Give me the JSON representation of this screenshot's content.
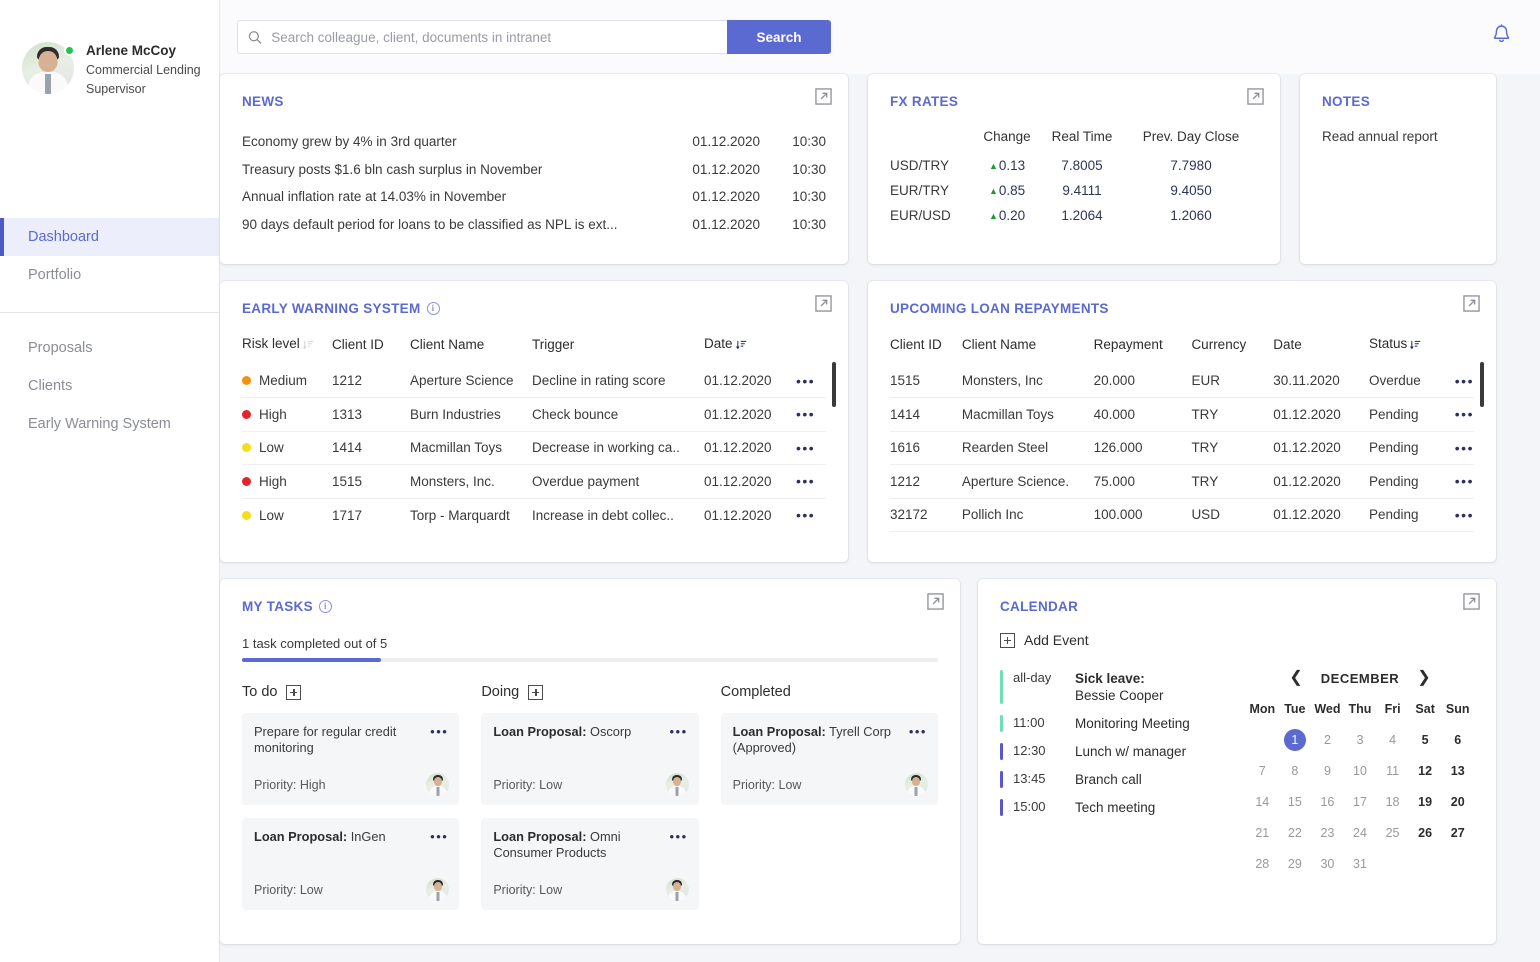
{
  "sidebar": {
    "profile": {
      "name": "Arlene McCoy",
      "role_line1": "Commercial Lending",
      "role_line2": "Supervisor"
    },
    "items": [
      {
        "label": "Dashboard",
        "active": true
      },
      {
        "label": "Portfolio",
        "active": false
      },
      {
        "label": "Proposals",
        "active": false
      },
      {
        "label": "Clients",
        "active": false
      },
      {
        "label": "Early Warning System",
        "active": false
      }
    ]
  },
  "topbar": {
    "search_placeholder": "Search colleague, client, documents in intranet",
    "search_value": "",
    "search_button": "Search",
    "bell_icon": "bell-icon"
  },
  "news": {
    "title": "NEWS",
    "rows": [
      {
        "title": "Economy grew by 4% in 3rd quarter",
        "date": "01.12.2020",
        "time": "10:30"
      },
      {
        "title": "Treasury posts $1.6 bln cash surplus in November",
        "date": "01.12.2020",
        "time": "10:30"
      },
      {
        "title": "Annual inflation rate at 14.03% in November",
        "date": "01.12.2020",
        "time": "10:30"
      },
      {
        "title": "90 days default period for loans to be classified as NPL is ext...",
        "date": "01.12.2020",
        "time": "10:30"
      }
    ]
  },
  "fx": {
    "title": "FX RATES",
    "headers": [
      "",
      "Change",
      "Real Time",
      "Prev. Day Close"
    ],
    "rows": [
      {
        "pair": "USD/TRY",
        "change": "0.13",
        "dir": "up",
        "real_time": "7.8005",
        "prev_close": "7.7980"
      },
      {
        "pair": "EUR/TRY",
        "change": "0.85",
        "dir": "up",
        "real_time": "9.4111",
        "prev_close": "9.4050"
      },
      {
        "pair": "EUR/USD",
        "change": "0.20",
        "dir": "up",
        "real_time": "1.2064",
        "prev_close": "1.2060"
      }
    ]
  },
  "notes": {
    "title": "NOTES",
    "body": "Read annual report"
  },
  "ews": {
    "title": "EARLY WARNING SYSTEM",
    "headers": [
      "Risk level",
      "Client ID",
      "Client Name",
      "Trigger",
      "Date"
    ],
    "rows": [
      {
        "risk": "Medium",
        "risk_color": "#f29212",
        "client_id": "1212",
        "client_name": "Aperture Science",
        "trigger": "Decline in rating score",
        "date": "01.12.2020"
      },
      {
        "risk": "High",
        "risk_color": "#e0262b",
        "client_id": "1313",
        "client_name": "Burn Industries",
        "trigger": "Check bounce",
        "date": "01.12.2020"
      },
      {
        "risk": "Low",
        "risk_color": "#f7dc1e",
        "client_id": "1414",
        "client_name": "Macmillan Toys",
        "trigger": "Decrease in working ca..",
        "date": "01.12.2020"
      },
      {
        "risk": "High",
        "risk_color": "#e0262b",
        "client_id": "1515",
        "client_name": "Monsters, Inc.",
        "trigger": "Overdue payment",
        "date": "01.12.2020"
      },
      {
        "risk": "Low",
        "risk_color": "#f7dc1e",
        "client_id": "1717",
        "client_name": "Torp - Marquardt",
        "trigger": "Increase in debt collec..",
        "date": "01.12.2020"
      }
    ]
  },
  "ulr": {
    "title": "UPCOMING LOAN REPAYMENTS",
    "headers": [
      "Client ID",
      "Client Name",
      "Repayment",
      "Currency",
      "Date",
      "Status"
    ],
    "rows": [
      {
        "client_id": "1515",
        "client_name": "Monsters, Inc",
        "repayment": "20.000",
        "currency": "EUR",
        "date": "30.11.2020",
        "status": "Overdue",
        "status_kind": "overdue"
      },
      {
        "client_id": "1414",
        "client_name": "Macmillan Toys",
        "repayment": "40.000",
        "currency": "TRY",
        "date": "01.12.2020",
        "status": "Pending",
        "status_kind": "pending"
      },
      {
        "client_id": "1616",
        "client_name": "Rearden Steel",
        "repayment": "126.000",
        "currency": "TRY",
        "date": "01.12.2020",
        "status": "Pending",
        "status_kind": "pending"
      },
      {
        "client_id": "1212",
        "client_name": "Aperture Science.",
        "repayment": "75.000",
        "currency": "TRY",
        "date": "01.12.2020",
        "status": "Pending",
        "status_kind": "pending"
      },
      {
        "client_id": "32172",
        "client_name": "Pollich Inc",
        "repayment": "100.000",
        "currency": "USD",
        "date": "01.12.2020",
        "status": "Pending",
        "status_kind": "pending"
      }
    ]
  },
  "tasks": {
    "title": "MY TASKS",
    "progress_label": "1 task completed out of 5",
    "progress_percent": 20,
    "columns": [
      {
        "name": "To do",
        "has_add": true,
        "cards": [
          {
            "prefix": "",
            "title": "Prepare for regular credit monitoring",
            "priority": "Priority: High"
          },
          {
            "prefix": "Loan Proposal:",
            "title": " InGen",
            "priority": "Priority: Low"
          }
        ]
      },
      {
        "name": "Doing",
        "has_add": true,
        "cards": [
          {
            "prefix": "Loan Proposal:",
            "title": " Oscorp",
            "priority": "Priority: Low"
          },
          {
            "prefix": "Loan Proposal:",
            "title": " Omni Consumer Products",
            "priority": "Priority: Low"
          }
        ]
      },
      {
        "name": "Completed",
        "has_add": false,
        "cards": [
          {
            "prefix": "Loan Proposal:",
            "title": " Tyrell Corp (Approved)",
            "priority": "Priority: Low"
          }
        ]
      }
    ]
  },
  "calendar": {
    "title": "CALENDAR",
    "add_event": "Add Event",
    "month": "DECEMBER",
    "prev_icon": "chevron-left-icon",
    "next_icon": "chevron-right-icon",
    "events": [
      {
        "time": "all-day",
        "name": "Sick leave:",
        "name2": "Bessie Cooper",
        "color": "#6fe0b6"
      },
      {
        "time": "11:00",
        "name": "Monitoring Meeting",
        "name2": "",
        "color": "#6fe0b6"
      },
      {
        "time": "12:30",
        "name": "Lunch w/ manager",
        "name2": "",
        "color": "#5b57c8"
      },
      {
        "time": "13:45",
        "name": "Branch call",
        "name2": "",
        "color": "#5b57c8"
      },
      {
        "time": "15:00",
        "name": "Tech meeting",
        "name2": "",
        "color": "#5b57c8"
      }
    ],
    "dow": [
      "Mon",
      "Tue",
      "Wed",
      "Thu",
      "Fri",
      "Sat",
      "Sun"
    ],
    "lead_blanks": 1,
    "today": 1,
    "days": [
      1,
      2,
      3,
      4,
      5,
      6,
      7,
      8,
      9,
      10,
      11,
      12,
      13,
      14,
      15,
      16,
      17,
      18,
      19,
      20,
      21,
      22,
      23,
      24,
      25,
      26,
      27,
      28,
      29,
      30,
      31
    ]
  },
  "theme": {
    "accent": "#5b6ad0",
    "overdue": "#e74c3c",
    "pending": "#f0a030",
    "page_bg": "#f4f5f8"
  }
}
